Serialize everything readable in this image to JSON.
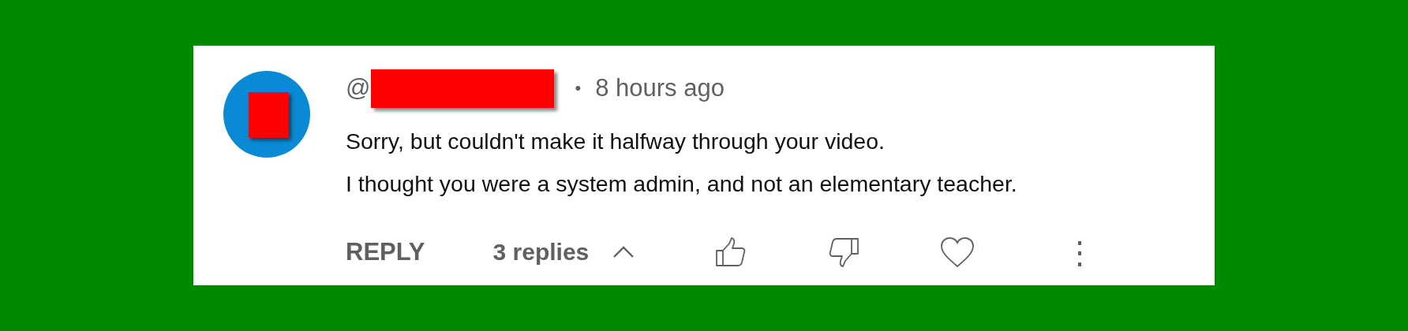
{
  "comment": {
    "at_sign": "@",
    "timestamp_separator": "•",
    "timestamp": "8 hours ago",
    "text_lines": [
      "Sorry, but couldn't make it halfway through your video.",
      "I thought you were a system admin, and not an elementary teacher."
    ],
    "reply_label": "REPLY",
    "replies_count": "3 replies",
    "replies_expanded": true,
    "menu_glyph": "⋮"
  }
}
